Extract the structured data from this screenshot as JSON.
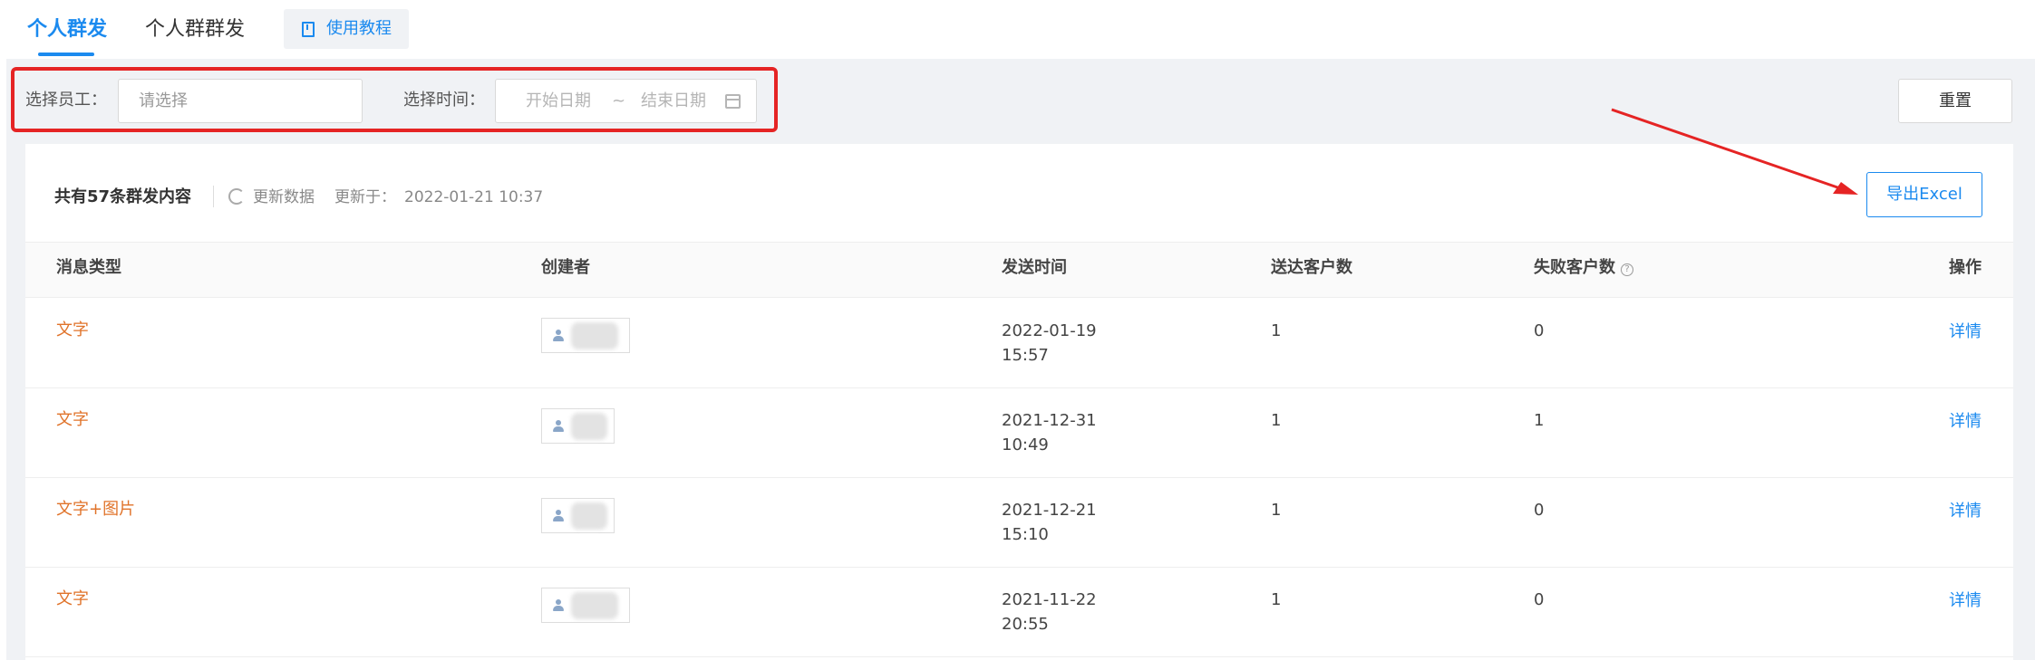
{
  "tabs": [
    {
      "label": "个人群发",
      "active": true
    },
    {
      "label": "个人群群发",
      "active": false
    }
  ],
  "tutorial": {
    "label": "使用教程"
  },
  "filters": {
    "staff_label": "选择员工：",
    "staff_placeholder": "请选择",
    "time_label": "选择时间：",
    "start_placeholder": "开始日期",
    "separator": "~",
    "end_placeholder": "结束日期",
    "reset_label": "重置"
  },
  "summary": {
    "count_text": "共有57条群发内容",
    "refresh_label": "更新数据",
    "updated_label": "更新于：",
    "updated_value": "2022-01-21 10:37"
  },
  "export": {
    "label": "导出Excel"
  },
  "table": {
    "headers": {
      "type": "消息类型",
      "creator": "创建者",
      "send_time": "发送时间",
      "delivered": "送达客户数",
      "failed": "失败客户数",
      "action": "操作"
    },
    "rows": [
      {
        "type": "文字",
        "date": "2022-01-19",
        "time": "15:57",
        "delivered": "1",
        "failed": "0",
        "action": "详情"
      },
      {
        "type": "文字",
        "date": "2021-12-31",
        "time": "10:49",
        "delivered": "1",
        "failed": "1",
        "action": "详情"
      },
      {
        "type": "文字+图片",
        "date": "2021-12-21",
        "time": "15:10",
        "delivered": "1",
        "failed": "0",
        "action": "详情"
      },
      {
        "type": "文字",
        "date": "2021-11-22",
        "time": "20:55",
        "delivered": "1",
        "failed": "0",
        "action": "详情"
      }
    ]
  },
  "colors": {
    "accent": "#1b8aef",
    "highlight": "#e52424",
    "type_text": "#e0732a",
    "page_bg": "#f0f2f5"
  }
}
